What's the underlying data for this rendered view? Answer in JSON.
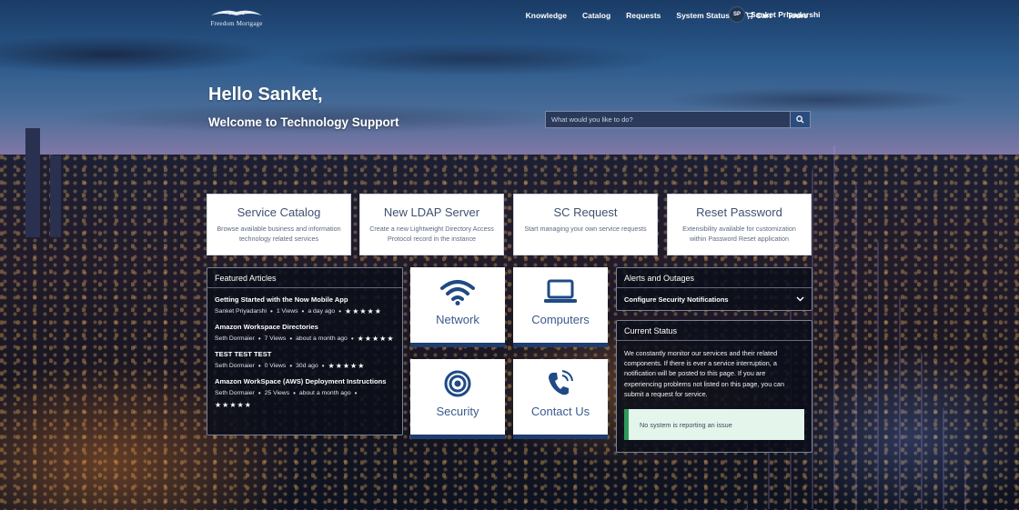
{
  "brand": {
    "logo_text": "Freedom Mortgage"
  },
  "nav": {
    "items": [
      "Knowledge",
      "Catalog",
      "Requests",
      "System Status",
      "Cart",
      "Tours"
    ],
    "user_initials": "SP",
    "user_name": "Sanket Priyadarshi"
  },
  "hero": {
    "greeting": "Hello Sanket,",
    "welcome": "Welcome to Technology Support",
    "search_placeholder": "What would you like to do?"
  },
  "quick_tiles": [
    {
      "title": "Service Catalog",
      "desc": "Browse available business and information technology related services"
    },
    {
      "title": "New LDAP Server",
      "desc": "Create a new Lightweight Directory Access Protocol record in the instance"
    },
    {
      "title": "SC Request",
      "desc": "Start managing your own service requests"
    },
    {
      "title": "Reset Password",
      "desc": "Extensibility available for customization within Password Reset application"
    }
  ],
  "featured": {
    "title": "Featured Articles",
    "articles": [
      {
        "title": "Getting Started with the Now Mobile App",
        "author": "Sanket Priyadarshi",
        "views": "1 Views",
        "time": "a day ago",
        "stars": "★★★★★"
      },
      {
        "title": "Amazon Workspace Directories",
        "author": "Seth Dormaier",
        "views": "7 Views",
        "time": "about a month ago",
        "stars": "★★★★★"
      },
      {
        "title": "TEST TEST TEST",
        "author": "Seth Dormaier",
        "views": "0 Views",
        "time": "30d ago",
        "stars": "★★★★★"
      },
      {
        "title": "Amazon WorkSpace (AWS) Deployment Instructions",
        "author": "Seth Dormaier",
        "views": "25 Views",
        "time": "about a month ago",
        "stars": "★★★★★"
      }
    ]
  },
  "icon_tiles": [
    {
      "label": "Network",
      "icon": "wifi-icon"
    },
    {
      "label": "Computers",
      "icon": "laptop-icon"
    },
    {
      "label": "Security",
      "icon": "target-icon"
    },
    {
      "label": "Contact Us",
      "icon": "phone-icon"
    }
  ],
  "alerts": {
    "title": "Alerts and Outages",
    "row_label": "Configure Security Notifications"
  },
  "status": {
    "title": "Current Status",
    "body": "We constantly monitor our services and their related components. If there is ever a service interruption, a notification will be posted to this page. If you are experiencing problems not listed on this page, you can submit a request for service.",
    "message": "No system is reporting an issue"
  },
  "colors": {
    "tile_accent": "#1f3d6e",
    "status_green": "#2e9a5c",
    "icon_blue": "#1f4a85"
  }
}
